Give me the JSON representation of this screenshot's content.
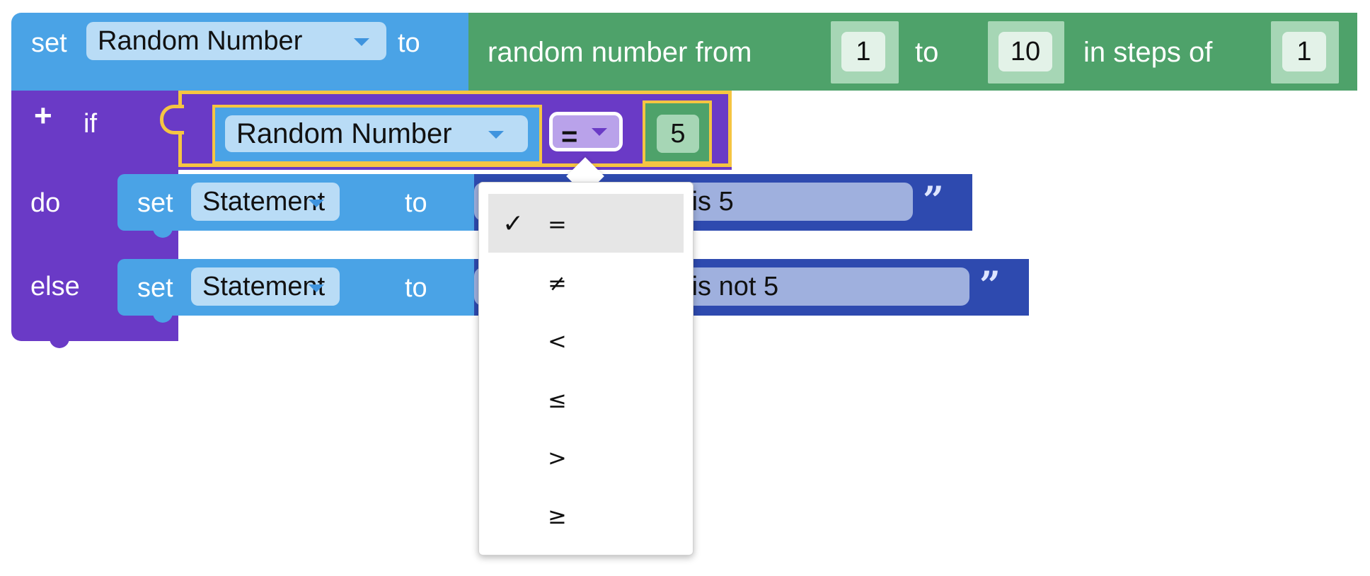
{
  "colors": {
    "variables_block": "#4aa3e6",
    "math_block": "#4ea26a",
    "logic_block": "#6a3ac6",
    "text_block": "#2e4aaf",
    "selection_highlight": "#f5c542"
  },
  "set_block": {
    "keyword": "set",
    "variable": "Random Number",
    "to": "to"
  },
  "random_block": {
    "label": "random number from",
    "from": "1",
    "to_label": "to",
    "to": "10",
    "steps_label": "in steps of",
    "step": "1"
  },
  "if_block": {
    "plus": "+",
    "if_label": "if",
    "do_label": "do",
    "else_label": "else",
    "condition": {
      "left_variable": "Random Number",
      "operator": "=",
      "right_value": "5"
    }
  },
  "do_statement": {
    "keyword": "set",
    "variable": "Statement",
    "to": "to",
    "text": "Random number is 5"
  },
  "else_statement": {
    "keyword": "set",
    "variable": "Statement",
    "to": "to",
    "text": "Random number is not 5"
  },
  "operator_menu": {
    "check_mark": "✓",
    "items": [
      "=",
      "≠",
      "<",
      "≤",
      ">",
      "≥"
    ],
    "selected": "="
  },
  "icons": {
    "caret": "chevron-down-icon",
    "quote": "quote-icon",
    "plus": "plus-icon",
    "check": "check-icon"
  },
  "quote_glyph": "”"
}
